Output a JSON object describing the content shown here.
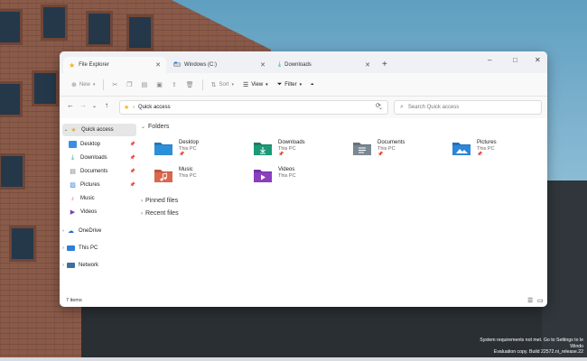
{
  "wallpaper": {
    "watermark_lines": [
      "System requirements not met. Go to Settings to le",
      "Windo",
      "Evaluation copy. Build 22572.ni_release.22"
    ]
  },
  "window": {
    "tabs": [
      {
        "label": "File Explorer",
        "icon": "star-icon",
        "active": true
      },
      {
        "label": "Windows (C:)",
        "icon": "drive-icon",
        "active": false
      },
      {
        "label": "Downloads",
        "icon": "download-icon",
        "active": false
      }
    ],
    "tab_close_glyph": "✕",
    "new_tab_glyph": "+",
    "controls": {
      "minimize": "–",
      "maximize": "□",
      "close": "✕"
    },
    "toolbar": {
      "new_label": "New",
      "sort_label": "Sort",
      "view_label": "View",
      "filter_label": "Filter",
      "more_glyph": "•••"
    },
    "address": {
      "location": "Quick access",
      "search_placeholder": "Search Quick access"
    },
    "sidebar": {
      "quick_access": "Quick access",
      "pinned": [
        {
          "label": "Desktop",
          "icon": "desktop-icon",
          "color": "#3a8ee6"
        },
        {
          "label": "Downloads",
          "icon": "download-icon",
          "color": "#1b9e77"
        },
        {
          "label": "Documents",
          "icon": "document-icon",
          "color": "#6f7b86"
        },
        {
          "label": "Pictures",
          "icon": "picture-icon",
          "color": "#2f7ed8"
        },
        {
          "label": "Music",
          "icon": "music-icon",
          "color": "#e0584a"
        },
        {
          "label": "Videos",
          "icon": "video-icon",
          "color": "#7b3fb5"
        }
      ],
      "onedrive": "OneDrive",
      "this_pc": "This PC",
      "network": "Network"
    },
    "main": {
      "folders_heading": "Folders",
      "folders": [
        {
          "name": "Desktop",
          "location": "This PC",
          "pinned": true,
          "color": "#2d8fd8",
          "icon": "desktop-icon"
        },
        {
          "name": "Downloads",
          "location": "This PC",
          "pinned": true,
          "color": "#1a9a78",
          "icon": "download-icon"
        },
        {
          "name": "Documents",
          "location": "This PC",
          "pinned": true,
          "color": "#7a8794",
          "icon": "document-icon"
        },
        {
          "name": "Pictures",
          "location": "This PC",
          "pinned": true,
          "color": "#2f86d6",
          "icon": "picture-icon"
        },
        {
          "name": "Music",
          "location": "This PC",
          "pinned": false,
          "color": "#d9684f",
          "icon": "music-icon"
        },
        {
          "name": "Videos",
          "location": "This PC",
          "pinned": false,
          "color": "#8a3fbe",
          "icon": "video-icon"
        }
      ],
      "pinned_files_heading": "Pinned files",
      "recent_files_heading": "Recent files"
    },
    "status": {
      "item_count": "7 items"
    }
  }
}
